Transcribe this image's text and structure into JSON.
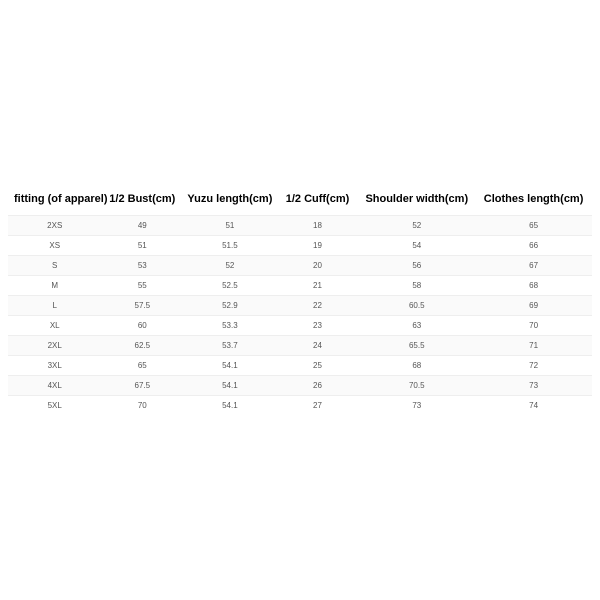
{
  "chart_data": {
    "type": "table",
    "headers": [
      "fitting (of apparel)",
      "1/2 Bust(cm)",
      "Yuzu length(cm)",
      "1/2 Cuff(cm)",
      "Shoulder width(cm)",
      "Clothes length(cm)"
    ],
    "rows": [
      {
        "cells": [
          "2XS",
          "49",
          "51",
          "18",
          "52",
          "65"
        ]
      },
      {
        "cells": [
          "XS",
          "51",
          "51.5",
          "19",
          "54",
          "66"
        ]
      },
      {
        "cells": [
          "S",
          "53",
          "52",
          "20",
          "56",
          "67"
        ]
      },
      {
        "cells": [
          "M",
          "55",
          "52.5",
          "21",
          "58",
          "68"
        ]
      },
      {
        "cells": [
          "L",
          "57.5",
          "52.9",
          "22",
          "60.5",
          "69"
        ]
      },
      {
        "cells": [
          "XL",
          "60",
          "53.3",
          "23",
          "63",
          "70"
        ]
      },
      {
        "cells": [
          "2XL",
          "62.5",
          "53.7",
          "24",
          "65.5",
          "71"
        ]
      },
      {
        "cells": [
          "3XL",
          "65",
          "54.1",
          "25",
          "68",
          "72"
        ]
      },
      {
        "cells": [
          "4XL",
          "67.5",
          "54.1",
          "26",
          "70.5",
          "73"
        ]
      },
      {
        "cells": [
          "5XL",
          "70",
          "54.1",
          "27",
          "73",
          "74"
        ]
      }
    ]
  }
}
